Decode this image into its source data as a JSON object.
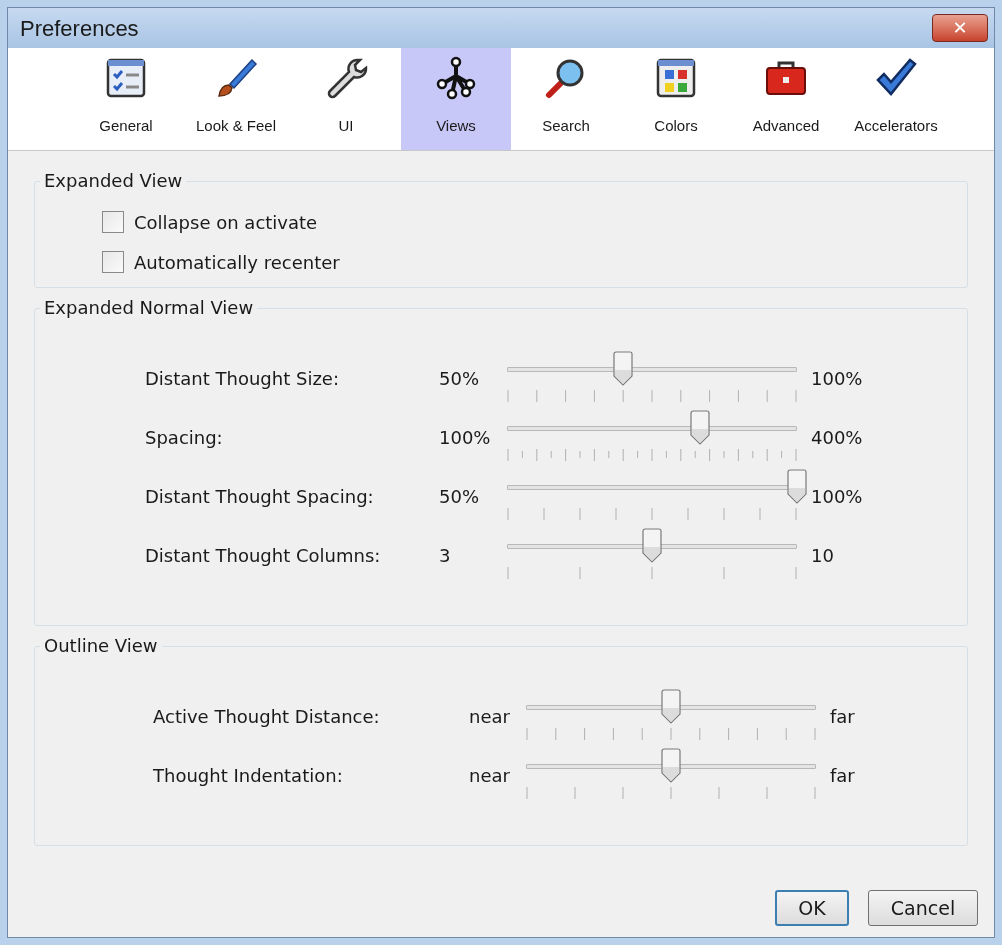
{
  "window": {
    "title": "Preferences",
    "close": "✕"
  },
  "tabs": [
    {
      "label": "General",
      "kind": "checklist",
      "selected": false
    },
    {
      "label": "Look & Feel",
      "kind": "brush",
      "selected": false
    },
    {
      "label": "UI",
      "kind": "wrench",
      "selected": false
    },
    {
      "label": "Views",
      "kind": "graph",
      "selected": true
    },
    {
      "label": "Search",
      "kind": "magnifier",
      "selected": false
    },
    {
      "label": "Colors",
      "kind": "palette",
      "selected": false
    },
    {
      "label": "Advanced",
      "kind": "toolbox",
      "selected": false
    },
    {
      "label": "Accelerators",
      "kind": "check",
      "selected": false
    }
  ],
  "expanded_view": {
    "title": "Expanded View",
    "options": [
      {
        "label": "Collapse on activate",
        "checked": false
      },
      {
        "label": "Automatically recenter",
        "checked": false
      }
    ]
  },
  "expanded_normal_view": {
    "title": "Expanded Normal View",
    "sliders": [
      {
        "label": "Distant Thought Size:",
        "min": "50%",
        "max": "100%",
        "level": 0.4
      },
      {
        "label": "Spacing:",
        "min": "100%",
        "max": "400%",
        "level": 0.667
      },
      {
        "label": "Distant Thought Spacing:",
        "min": "50%",
        "max": "100%",
        "level": 1
      },
      {
        "label": "Distant Thought Columns:",
        "min": "3",
        "max": "10",
        "level": 0.5
      }
    ]
  },
  "outline_view": {
    "title": "Outline View",
    "sliders": [
      {
        "label": "Active Thought Distance:",
        "min": "near",
        "max": "far",
        "level": 0.5
      },
      {
        "label": "Thought Indentation:",
        "min": "near",
        "max": "far",
        "level": 0.5
      }
    ]
  },
  "buttons": [
    {
      "label": "OK",
      "default": true
    },
    {
      "label": "Cancel",
      "default": false
    }
  ]
}
